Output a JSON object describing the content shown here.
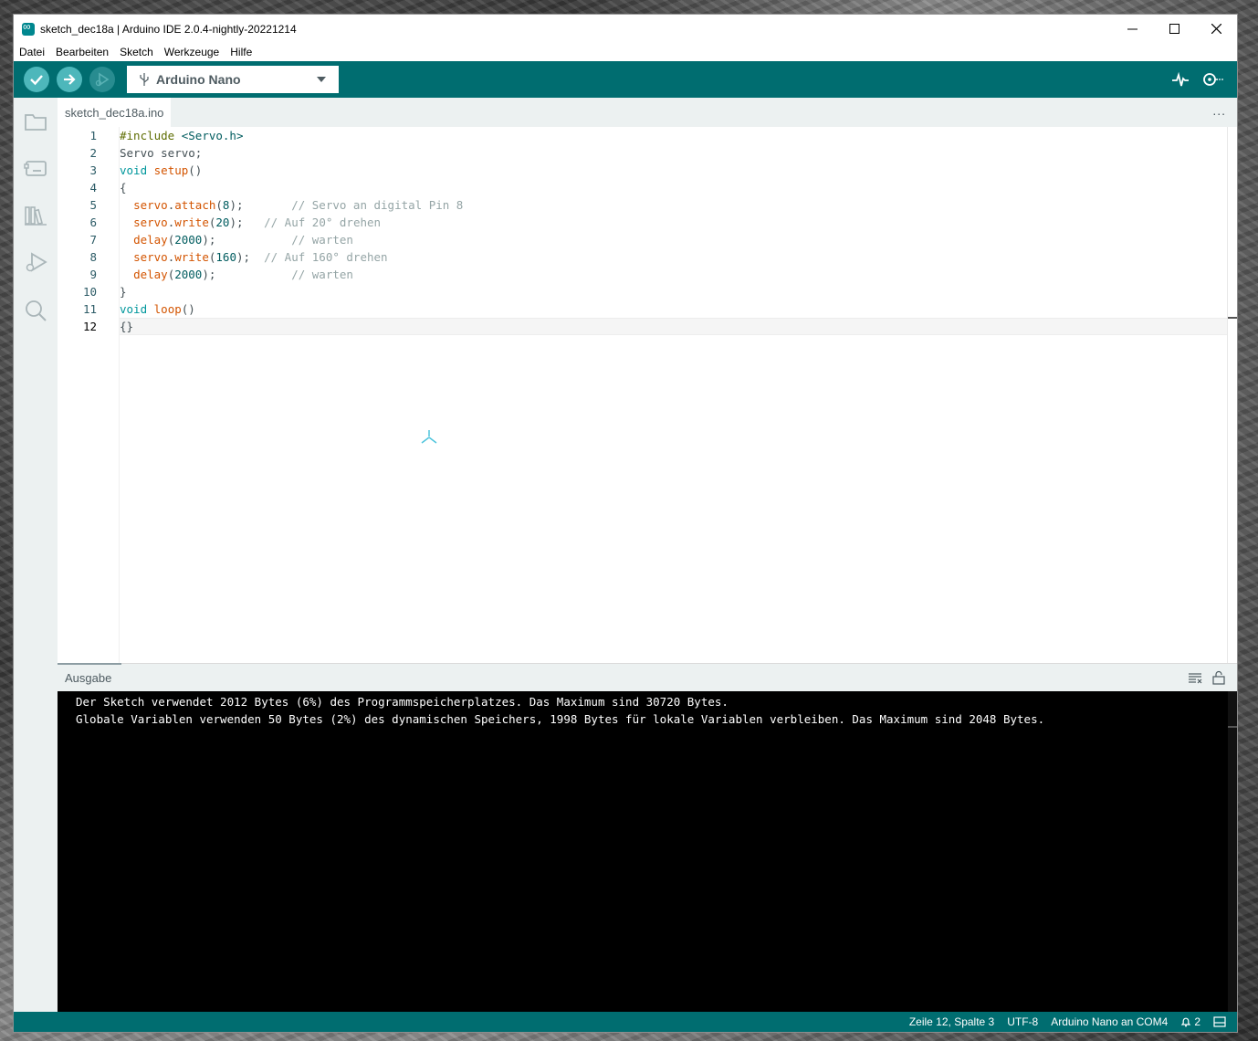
{
  "window": {
    "title": "sketch_dec18a | Arduino IDE 2.0.4-nightly-20221214"
  },
  "menu": [
    "Datei",
    "Bearbeiten",
    "Sketch",
    "Werkzeuge",
    "Hilfe"
  ],
  "toolbar": {
    "verify_icon": "check-icon",
    "upload_icon": "arrow-right-icon",
    "debug_icon": "debug-icon",
    "board": "Arduino Nano",
    "serial_plotter_icon": "serial-plotter-icon",
    "serial_monitor_icon": "serial-monitor-icon"
  },
  "sidebar": [
    "folder-icon",
    "board-manager-icon",
    "library-icon",
    "debug-icon",
    "search-icon"
  ],
  "editor": {
    "tab_label": "sketch_dec18a.ino",
    "tab_more": "...",
    "line_numbers": [
      "1",
      "2",
      "3",
      "4",
      "5",
      "6",
      "7",
      "8",
      "9",
      "10",
      "11",
      "12"
    ],
    "current_line": 12
  },
  "output": {
    "title": "Ausgabe",
    "lines": [
      "Der Sketch verwendet 2012 Bytes (6%) des Programmspeicherplatzes. Das Maximum sind 30720 Bytes.",
      "Globale Variablen verwenden 50 Bytes (2%) des dynamischen Speichers, 1998 Bytes für lokale Variablen verbleiben. Das Maximum sind 2048 Bytes."
    ]
  },
  "status": {
    "position": "Zeile 12, Spalte 3",
    "encoding": "UTF-8",
    "board_port": "Arduino Nano an COM4",
    "notifications": "2"
  },
  "colors": {
    "teal": "#006d70",
    "teal_button": "#4db7bb",
    "sidebar_bg": "#ecf1f1"
  }
}
